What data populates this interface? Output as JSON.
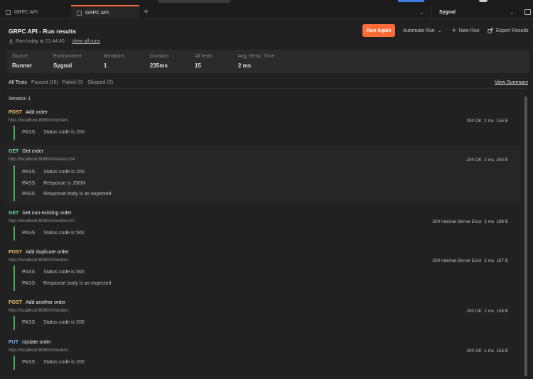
{
  "tabs": [
    {
      "label": "GRPC API"
    },
    {
      "label": "GRPC API"
    }
  ],
  "environment_selector": {
    "value": "Sygnal"
  },
  "header": {
    "title": "GRPC API - Run results",
    "ran_text": "Ran today at 21:44:49",
    "separator": "·",
    "view_all_runs": "View all runs",
    "run_again": "Run Again",
    "automate_run": "Automate Run",
    "new_run": "New Run",
    "export_results": "Export Results"
  },
  "summary": {
    "source_label": "Source",
    "source_value": "Runner",
    "environment_label": "Environment",
    "environment_value": "Sygnal",
    "iterations_label": "Iterations",
    "iterations_value": "1",
    "duration_label": "Duration",
    "duration_value": "235ms",
    "all_tests_label": "All tests",
    "all_tests_value": "15",
    "avg_resp_label": "Avg. Resp. Time",
    "avg_resp_value": "2 ms"
  },
  "filters": {
    "all": "All Tests",
    "passed": "Passed (15)",
    "failed": "Failed (0)",
    "skipped": "Skipped (0)",
    "view_summary": "View Summary"
  },
  "iteration_label": "Iteration 1",
  "requests": [
    {
      "method": "POST",
      "name": "Add order",
      "url": "http://localhost:8080/v0/orders",
      "status": "200 OK",
      "time": "2 ms",
      "size": "155 B",
      "tests": [
        {
          "result": "PASS",
          "name": "Status code is 200"
        }
      ]
    },
    {
      "method": "GET",
      "name": "Get order",
      "url": "http://localhost:8080/v0/orders/14",
      "status": "200 OK",
      "time": "2 ms",
      "size": "354 B",
      "tests": [
        {
          "result": "PASS",
          "name": "Status code is 200"
        },
        {
          "result": "PASS",
          "name": "Response is JSON"
        },
        {
          "result": "PASS",
          "name": "Response body is as expected"
        }
      ]
    },
    {
      "method": "GET",
      "name": "Get non-exisitng order",
      "url": "http://localhost:8080/v0/orders/10",
      "status": "500 Internal Server Error",
      "time": "2 ms",
      "size": "196 B",
      "tests": [
        {
          "result": "PASS",
          "name": "Status code is 500"
        }
      ]
    },
    {
      "method": "POST",
      "name": "Add duplicate order",
      "url": "http://localhost:8080/v0/orders",
      "status": "500 Internal Server Error",
      "time": "2 ms",
      "size": "187 B",
      "tests": [
        {
          "result": "PASS",
          "name": "Status code is 500"
        },
        {
          "result": "PASS",
          "name": "Response body is as expected"
        }
      ]
    },
    {
      "method": "POST",
      "name": "Add another order",
      "url": "http://localhost:8080/v0/orders",
      "status": "200 OK",
      "time": "2 ms",
      "size": "155 B",
      "tests": [
        {
          "result": "PASS",
          "name": "Status code is 200"
        }
      ]
    },
    {
      "method": "PUT",
      "name": "Update order",
      "url": "http://localhost:8080/v0/orders",
      "status": "200 OK",
      "time": "1 ms",
      "size": "155 B",
      "tests": [
        {
          "result": "PASS",
          "name": "Status code is 200"
        }
      ]
    }
  ],
  "colors": {
    "accent": "#ff6c37",
    "post": "#f5c26b",
    "get": "#6bdd9a",
    "put": "#74aef6",
    "pass_bar": "#4caf50"
  }
}
